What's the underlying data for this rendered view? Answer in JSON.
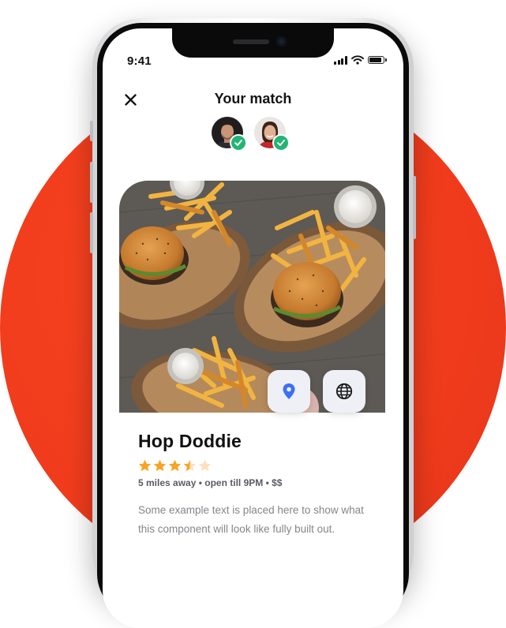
{
  "status_bar": {
    "time": "9:41"
  },
  "header": {
    "title": "Your match"
  },
  "restaurant": {
    "name": "Hop Doddie",
    "rating": 3.5,
    "rating_max": 5,
    "meta": "5 miles away • open till 9PM • $$",
    "description": "Some example text is placed here to show what this component will look like fully built out."
  },
  "icons": {
    "close": "close-icon",
    "location": "map-pin-icon",
    "website": "globe-icon",
    "verified": "check-icon",
    "star": "star-icon"
  },
  "colors": {
    "accent": "#ef3b1c",
    "verified_badge": "#22b573",
    "star_filled": "#f7a325",
    "star_empty": "#fde1bc",
    "location_pin": "#3b6ff5"
  }
}
